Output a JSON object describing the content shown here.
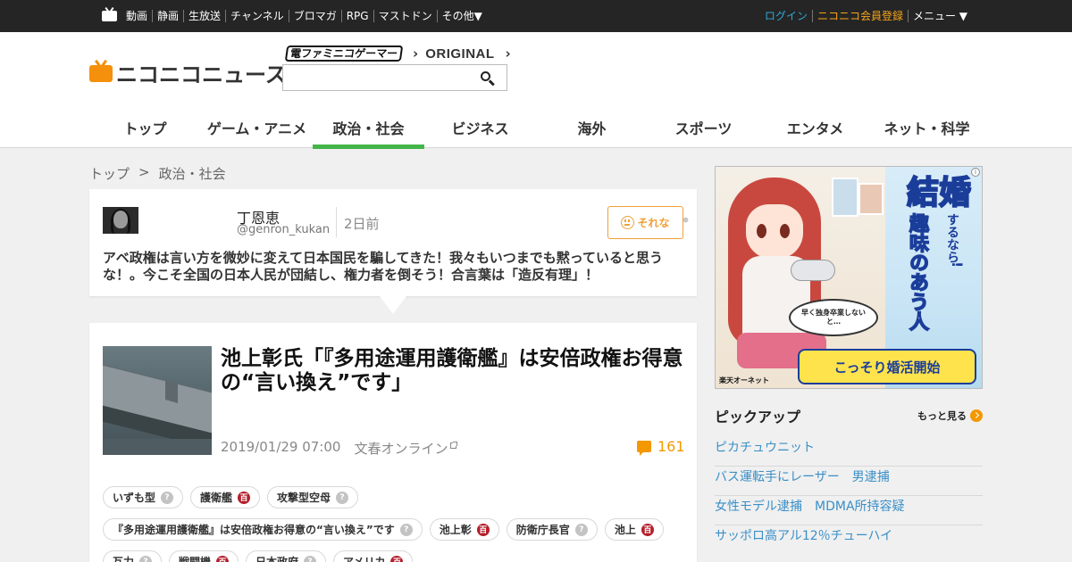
{
  "topbar": {
    "nav": [
      "動画",
      "静画",
      "生放送",
      "チャンネル",
      "ブロマガ",
      "RPG",
      "マストドン",
      "その他▼"
    ],
    "login": "ログイン",
    "register": "ニコニコ会員登録",
    "menu": "メニュー ▼"
  },
  "header": {
    "logo_text": "ニコニコニュース",
    "partner_dengeki": "電ファミニコゲーマー",
    "partner_original": "ORIGINAL",
    "search_placeholder": "",
    "categories": [
      "トップ",
      "ゲーム・アニメ",
      "政治・社会",
      "ビジネス",
      "海外",
      "スポーツ",
      "エンタメ",
      "ネット・科学"
    ],
    "active_category": "政治・社会"
  },
  "breadcrumb": {
    "home": "トップ",
    "sep": ">",
    "current": "政治・社会"
  },
  "comment": {
    "user_name": "丁恩恵",
    "user_handle": "@genron_kukan",
    "time": "2日前",
    "more": "•••",
    "reaction_label": "それな",
    "body": "アベ政権は言い方を微妙に変えて日本国民を騙してきた！我々もいつまでも黙っていると思うな！。今こそ全国の日本人民が団結し、権力者を倒そう！合言葉は「造反有理」！"
  },
  "article": {
    "title": "池上彰氏「『多用途運用護衛艦』は安倍政権お得意の“言い換え”です」",
    "date": "2019/01/29 07:00",
    "source": "文春オンライン",
    "comment_count": "161",
    "tag_rows": [
      [
        {
          "label": "いずも型",
          "icon": "question"
        },
        {
          "label": "護衛艦",
          "icon": "dic"
        },
        {
          "label": "攻撃型空母",
          "icon": "question"
        }
      ],
      [
        {
          "label": "『多用途運用護衛艦』は安倍政権お得意の“言い換え”です",
          "icon": "question"
        },
        {
          "label": "池上彰",
          "icon": "dic"
        },
        {
          "label": "防衛庁長官",
          "icon": "question"
        },
        {
          "label": "池上",
          "icon": "dic"
        }
      ],
      [
        {
          "label": "互力",
          "icon": "question"
        },
        {
          "label": "戦闘機",
          "icon": "dic"
        },
        {
          "label": "日本政府",
          "icon": "question"
        },
        {
          "label": "アメリカ",
          "icon": "dic"
        }
      ]
    ],
    "icon_question_glyph": "?",
    "icon_dic_glyph": "百"
  },
  "ad": {
    "brand": "楽天オーネット",
    "catch_big": "結婚",
    "catch_small1": "するなら",
    "catch_line2": "趣味のあう人",
    "catch_small2": "!",
    "speech": "早く独身卒業しないと…",
    "cta": "こっそり婚活開始",
    "info_icon": "i"
  },
  "pickup": {
    "title": "ピックアップ",
    "more": "もっと見る",
    "items": [
      "ピカチュウニット",
      "バス運転手にレーザー　男逮捕",
      "女性モデル逮捕　MDMA所持容疑",
      "サッポロ高アル12％チューハイ"
    ]
  },
  "colors": {
    "topbar": "#252525",
    "accent_green": "#43b549",
    "accent_orange": "#f39800",
    "link_blue": "#3a8fc7",
    "login_blue": "#2fa8d8"
  }
}
